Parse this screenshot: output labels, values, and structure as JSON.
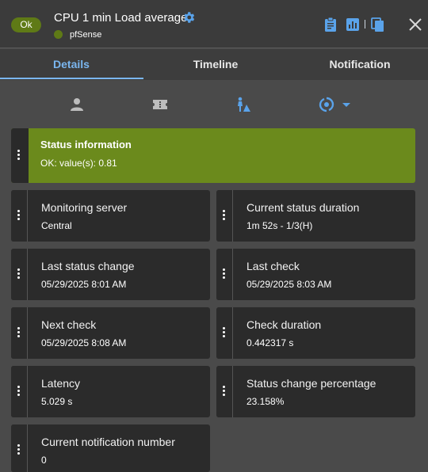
{
  "header": {
    "status_badge": "Ok",
    "title": "CPU 1 min Load average",
    "host": "pfSense",
    "status_color": "#5f7a16",
    "icons": [
      "gear-icon",
      "clipboard-icon",
      "chart-icon",
      "copy-icon",
      "close-icon"
    ]
  },
  "tabs": [
    {
      "label": "Details",
      "active": true
    },
    {
      "label": "Timeline",
      "active": false
    },
    {
      "label": "Notification",
      "active": false
    }
  ],
  "icon_row": [
    "user-icon",
    "ticket-icon",
    "acknowledge-icon",
    "refresh-icon",
    "dropdown-arrow-icon"
  ],
  "status": {
    "title": "Status information",
    "text": "OK: value(s): 0.81",
    "color": "#6b8a1c"
  },
  "cards": [
    {
      "label": "Monitoring server",
      "value": "Central"
    },
    {
      "label": "Current status duration",
      "value": "1m 52s - 1/3(H)"
    },
    {
      "label": "Last status change",
      "value": "05/29/2025 8:01 AM"
    },
    {
      "label": "Last check",
      "value": "05/29/2025 8:03 AM"
    },
    {
      "label": "Next check",
      "value": "05/29/2025 8:08 AM"
    },
    {
      "label": "Check duration",
      "value": "0.442317 s"
    },
    {
      "label": "Latency",
      "value": "5.029 s"
    },
    {
      "label": "Status change percentage",
      "value": "23.158%"
    },
    {
      "label": "Current notification number",
      "value": "0"
    }
  ]
}
